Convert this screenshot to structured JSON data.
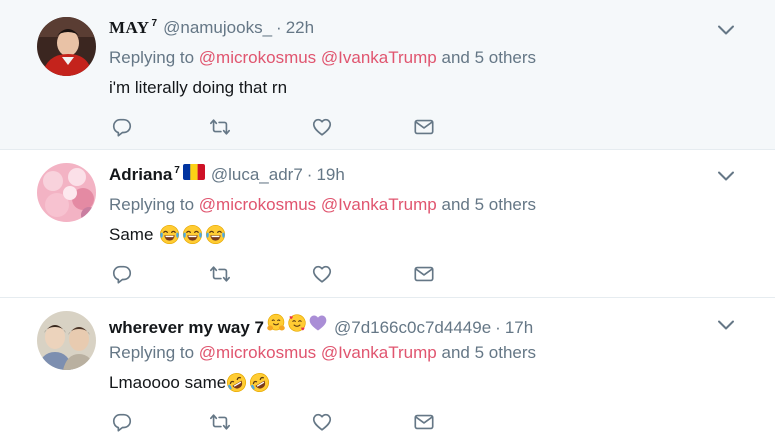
{
  "colors": {
    "background_highlight": "#f5f8fa",
    "text_primary": "#14171a",
    "text_secondary": "#657786",
    "mention": "#e0556f",
    "divider": "#e6ecf0",
    "icon": "#657786"
  },
  "tweets": [
    {
      "display_name": "MAY",
      "name_suffix": "7",
      "handle": "@namujooks_",
      "separator": "·",
      "time": "22h",
      "replying_prefix": "Replying to",
      "mention_1": "@microkosmus",
      "mention_2": "@IvankaTrump",
      "replying_suffix": "and 5 others",
      "text": "i'm literally doing that rn",
      "avatar": "avatar-red-jacket",
      "actions": [
        "reply-icon",
        "retweet-icon",
        "like-icon",
        "message-icon"
      ]
    },
    {
      "display_name": "Adriana",
      "name_suffix": "7",
      "name_emoji": "romania-flag",
      "handle": "@luca_adr7",
      "separator": "·",
      "time": "19h",
      "replying_prefix": "Replying to",
      "mention_1": "@microkosmus",
      "mention_2": "@IvankaTrump",
      "replying_suffix": "and 5 others",
      "text": "Same",
      "text_emojis": [
        "tears-of-joy-emoji",
        "tears-of-joy-emoji",
        "tears-of-joy-emoji"
      ],
      "avatar": "avatar-pink-bokeh",
      "actions": [
        "reply-icon",
        "retweet-icon",
        "like-icon",
        "message-icon"
      ]
    },
    {
      "display_name": "wherever my way 7",
      "name_emojis": [
        "hugging-face-emoji",
        "smiling-face-with-hearts-emoji",
        "purple-heart-emoji"
      ],
      "handle": "@7d166c0c7d4449e",
      "separator": "·",
      "time": "17h",
      "replying_prefix": "Replying to",
      "mention_1": "@microkosmus",
      "mention_2": "@IvankaTrump",
      "replying_suffix": "and 5 others",
      "text": "Lmaoooo same",
      "text_emojis": [
        "rolling-on-floor-laughing-emoji",
        "rolling-on-floor-laughing-emoji"
      ],
      "avatar": "avatar-two-people",
      "actions": [
        "reply-icon",
        "retweet-icon",
        "like-icon",
        "message-icon"
      ]
    }
  ]
}
